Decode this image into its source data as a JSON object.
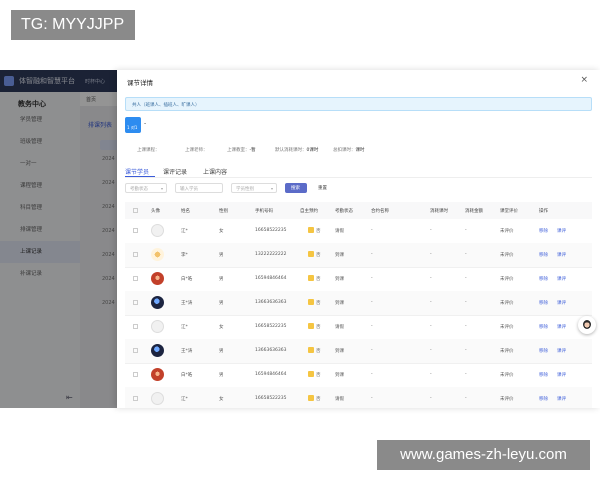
{
  "watermarks": {
    "top": "TG: MYYJJPP",
    "bottom": "www.games-zh-leyu.com"
  },
  "app": {
    "title": "体智融和智慧平台",
    "topbar_hint": "时杯中心",
    "side_header": "教务中心",
    "side_items": [
      "学员管理",
      "班级管理",
      "一对一",
      "课程管理",
      "科目管理",
      "排课管理",
      "上课记录",
      "补课记录"
    ],
    "active_side_index": 6,
    "tab_strip": "首页",
    "breadcrumb": "排课列表",
    "years": [
      "2024",
      "2024",
      "2024",
      "2024",
      "2024",
      "2024",
      "2024"
    ]
  },
  "modal": {
    "title": "课节详情",
    "close": "×",
    "notice": "共人（班课人、插班人、旷课人）",
    "course_badge": "1 对1",
    "course_dot": "-",
    "info": [
      {
        "label": "上课课程：",
        "value": ""
      },
      {
        "label": "上课老师：",
        "value": ""
      },
      {
        "label": "上课教室：",
        "value": "-暂"
      },
      {
        "label": "默认消耗课时：",
        "value": "0课时"
      },
      {
        "label": "总扣课时：",
        "value": "课时"
      }
    ],
    "tabs": [
      "课节学员",
      "课评记录",
      "上课内容"
    ],
    "active_tab": 0,
    "filters": {
      "attendance_placeholder": "考勤状态",
      "name_placeholder": "输入学员",
      "gender_placeholder": "学员性别",
      "search": "搜索",
      "reset": "重置"
    },
    "columns": [
      "头像",
      "姓名",
      "性别",
      "手机号码",
      "自主预约",
      "考勤状态",
      "合约名称",
      "消耗课时",
      "消耗金额",
      "课堂评价",
      "操作"
    ],
    "rows": [
      {
        "avatar": "plain",
        "name": "江*",
        "gender": "女",
        "phone": "16658522235",
        "self": "否",
        "status": "请假",
        "contract": "-",
        "hours": "-",
        "amount": "-",
        "review": "未评价",
        "a1": "移除",
        "a2": "课评"
      },
      {
        "avatar": "cat",
        "name": "李*",
        "gender": "男",
        "phone": "13222222222",
        "self": "否",
        "status": "到课",
        "contract": "-",
        "hours": "-",
        "amount": "-",
        "review": "未评价",
        "a1": "移除",
        "a2": "课评"
      },
      {
        "avatar": "red",
        "name": "白*皓",
        "gender": "男",
        "phone": "16594846464",
        "self": "否",
        "status": "到课",
        "contract": "-",
        "hours": "-",
        "amount": "-",
        "review": "未评价",
        "a1": "移除",
        "a2": "课评"
      },
      {
        "avatar": "dark",
        "name": "王*涛",
        "gender": "男",
        "phone": "13663636363",
        "self": "否",
        "status": "到课",
        "contract": "-",
        "hours": "-",
        "amount": "-",
        "review": "未评价",
        "a1": "移除",
        "a2": "课评"
      },
      {
        "avatar": "plain",
        "name": "江*",
        "gender": "女",
        "phone": "16658522235",
        "self": "否",
        "status": "请假",
        "contract": "-",
        "hours": "-",
        "amount": "-",
        "review": "未评价",
        "a1": "移除",
        "a2": "课评"
      },
      {
        "avatar": "dark",
        "name": "王*涛",
        "gender": "男",
        "phone": "13663636363",
        "self": "否",
        "status": "到课",
        "contract": "-",
        "hours": "-",
        "amount": "-",
        "review": "未评价",
        "a1": "移除",
        "a2": "课评"
      },
      {
        "avatar": "red",
        "name": "白*皓",
        "gender": "男",
        "phone": "16594846464",
        "self": "否",
        "status": "到课",
        "contract": "-",
        "hours": "-",
        "amount": "-",
        "review": "未评价",
        "a1": "移除",
        "a2": "课评"
      },
      {
        "avatar": "plain",
        "name": "江*",
        "gender": "女",
        "phone": "16658522235",
        "self": "否",
        "status": "请假",
        "contract": "-",
        "hours": "-",
        "amount": "-",
        "review": "未评价",
        "a1": "移除",
        "a2": "课评"
      }
    ]
  },
  "icons": {
    "close": "close-icon",
    "menu_fold": "menu-fold-icon",
    "support": "support-avatar-icon"
  },
  "colors": {
    "accent": "#3a5bd9",
    "header_dark": "#2f3b5c",
    "notice_bg": "#e6f4fd",
    "search_btn": "#5b6bc8"
  }
}
